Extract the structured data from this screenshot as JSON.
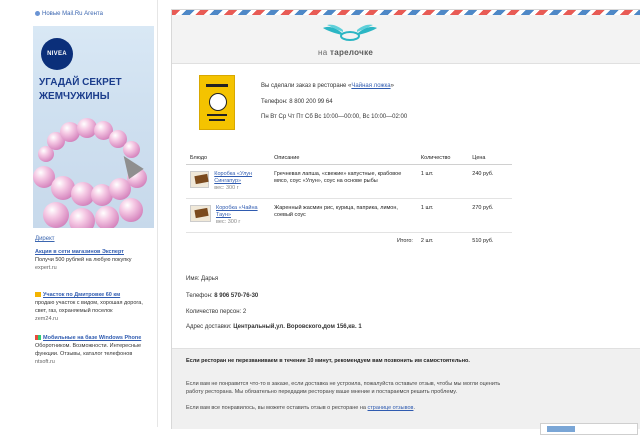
{
  "left": {
    "top_link": "Новые Mail.Ru Агента",
    "banner": {
      "brand": "NIVEA",
      "headline": "УГАДАЙ СЕКРЕТ ЖЕМЧУЖИНЫ"
    },
    "direct_label": "Директ",
    "ads": [
      {
        "title": "Акция в сети магазинов Эксперт",
        "text": "Получи 500 рублей на любую покупку",
        "url": "expert.ru"
      },
      {
        "title": "Участок по Дмитровке 60 км",
        "text": "продаю участок с видом, хорошая дорога, свет, газ, охраняемый поселок",
        "url": "zem24.ru"
      },
      {
        "title": "Мобильные на базе Windows Phone",
        "text": "Оборотником. Возможности. Интересные функции. Отзывы, каталог телефонов",
        "url": "ntsoft.ru"
      }
    ]
  },
  "card": {
    "logo": {
      "prefix": "на ",
      "name": "тарелочке"
    },
    "order": {
      "intro": "Вы сделали заказ в ресторане «",
      "restaurant": "Чайная ложка",
      "intro_end": "»",
      "phone": "Телефон: 8 800 200 99 64",
      "hours": "Пн Вт Ср Чт Пт Сб Вс 10:00—00:00, Вс 10:00—02:00"
    },
    "table": {
      "headers": [
        "Блюдо",
        "Описание",
        "Количество",
        "Цена"
      ],
      "rows": [
        {
          "name": "Коробка «Улун Сингапур»",
          "weight": "вес: 300 г",
          "desc": "Гречневая лапша, «свежие» капустные, крабовое мясо, соус «Улун», соус на основе рыбы",
          "qty": "1 шт.",
          "price": "240 руб."
        },
        {
          "name": "Коробка «Чайна Таун»",
          "weight": "вес: 300 г",
          "desc": "Жаренный жасмин рис, курица, паприка, лимон, соевый соус",
          "qty": "1 шт.",
          "price": "270 руб."
        }
      ],
      "total_label": "Итого:",
      "total_qty": "2 шт.",
      "total_price": "510 руб."
    },
    "customer": {
      "name": "Имя: Дарья",
      "phone_label": "Телефон: ",
      "phone": "8 906 570-76-30",
      "persons": "Количество персон: 2",
      "address_label": "Адрес доставки: ",
      "address": "Центральный,ул. Воровского,дом 156,кв. 1"
    },
    "footer": {
      "note_bold": "Если ресторан не перезваниваем в течение 10 минут, рекомендуем вам позвонить им самостоятельно.",
      "note_2": "Если вам не понравится что-то в заказе, если доставка не устроила, пожалуйста оставьте отзыв, чтобы мы могли оценить работу ресторана. Мы обязательно передадим ресторану ваше мнение и постараемся решить проблему.",
      "note_3_pre": "Если вам все понравилось, вы можете оставить отзыв о ресторане на ",
      "note_3_link": "странице отзывов",
      "note_3_post": "."
    }
  }
}
